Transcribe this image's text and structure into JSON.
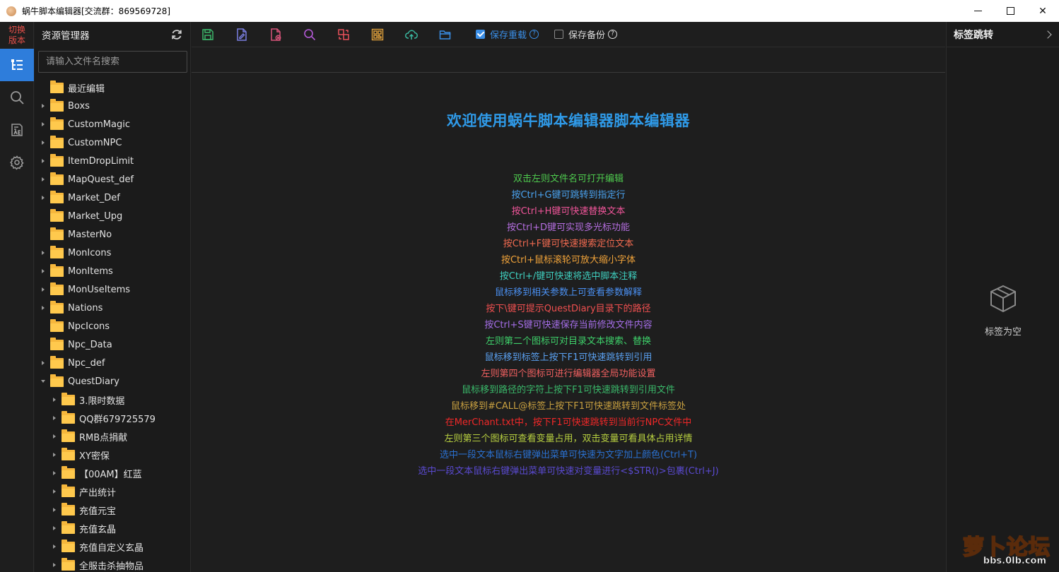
{
  "window": {
    "title": "蜗牛脚本编辑器[交流群：869569728]",
    "controls": {
      "minimize": "minimize-icon",
      "maximize": "maximize-icon",
      "close": "✕"
    }
  },
  "activity_bar": {
    "switch_version": [
      "切换",
      "版本"
    ],
    "items": [
      {
        "icon": "file-tree-icon",
        "active": true
      },
      {
        "icon": "search-icon",
        "active": false
      },
      {
        "icon": "variable-icon",
        "active": false
      },
      {
        "icon": "gear-icon",
        "active": false
      }
    ]
  },
  "explorer": {
    "title": "资源管理器",
    "search_placeholder": "请输入文件名搜索",
    "tree": [
      {
        "label": "最近编辑",
        "depth": 0,
        "caret": "none"
      },
      {
        "label": "Boxs",
        "depth": 0,
        "caret": "right"
      },
      {
        "label": "CustomMagic",
        "depth": 0,
        "caret": "right"
      },
      {
        "label": "CustomNPC",
        "depth": 0,
        "caret": "right"
      },
      {
        "label": "ItemDropLimit",
        "depth": 0,
        "caret": "right"
      },
      {
        "label": "MapQuest_def",
        "depth": 0,
        "caret": "right"
      },
      {
        "label": "Market_Def",
        "depth": 0,
        "caret": "right"
      },
      {
        "label": "Market_Upg",
        "depth": 0,
        "caret": "none"
      },
      {
        "label": "MasterNo",
        "depth": 0,
        "caret": "none"
      },
      {
        "label": "MonIcons",
        "depth": 0,
        "caret": "right"
      },
      {
        "label": "MonItems",
        "depth": 0,
        "caret": "right"
      },
      {
        "label": "MonUseItems",
        "depth": 0,
        "caret": "right"
      },
      {
        "label": "Nations",
        "depth": 0,
        "caret": "right"
      },
      {
        "label": "NpcIcons",
        "depth": 0,
        "caret": "none"
      },
      {
        "label": "Npc_Data",
        "depth": 0,
        "caret": "none"
      },
      {
        "label": "Npc_def",
        "depth": 0,
        "caret": "right"
      },
      {
        "label": "QuestDiary",
        "depth": 0,
        "caret": "down"
      },
      {
        "label": "3.限时数据",
        "depth": 1,
        "caret": "right"
      },
      {
        "label": "QQ群679725579",
        "depth": 1,
        "caret": "right"
      },
      {
        "label": "RMB点捐献",
        "depth": 1,
        "caret": "right"
      },
      {
        "label": "XY密保",
        "depth": 1,
        "caret": "right"
      },
      {
        "label": "【00AM】红蓝",
        "depth": 1,
        "caret": "right"
      },
      {
        "label": "产出统计",
        "depth": 1,
        "caret": "right"
      },
      {
        "label": "充值元宝",
        "depth": 1,
        "caret": "right"
      },
      {
        "label": "充值玄晶",
        "depth": 1,
        "caret": "right"
      },
      {
        "label": "充值自定义玄晶",
        "depth": 1,
        "caret": "right"
      },
      {
        "label": "全服击杀抽物品",
        "depth": 1,
        "caret": "right"
      }
    ]
  },
  "toolbar": {
    "buttons": [
      {
        "icon": "save-icon",
        "color": "#3bb56a"
      },
      {
        "icon": "edit-file-icon",
        "color": "#7a7fe0"
      },
      {
        "icon": "close-file-icon",
        "color": "#d9547a"
      },
      {
        "icon": "search-icon",
        "color": "#b45ad8"
      },
      {
        "icon": "replace-icon",
        "color": "#e8505a"
      },
      {
        "icon": "qrcode-icon",
        "color": "#e0a03a"
      },
      {
        "icon": "cloud-upload-icon",
        "color": "#3ab8a0"
      },
      {
        "icon": "folder-open-icon",
        "color": "#3a8ee6"
      }
    ],
    "save_reload": {
      "label": "保存重载",
      "checked": true,
      "color": "#3a8ee6"
    },
    "save_backup": {
      "label": "保存备份",
      "checked": false,
      "color": "#dddddd"
    }
  },
  "welcome": {
    "title": "欢迎使用蜗牛脚本编辑器脚本编辑器",
    "tips": [
      {
        "text": "双击左则文件名可打开编辑",
        "color": "#4ec94e"
      },
      {
        "text": "按Ctrl+G键可跳转到指定行",
        "color": "#4aa3f0"
      },
      {
        "text": "按Ctrl+H键可快速替换文本",
        "color": "#f0559a"
      },
      {
        "text": "按Ctrl+D键可实现多光标功能",
        "color": "#b56ee0"
      },
      {
        "text": "按Ctrl+F键可快速搜索定位文本",
        "color": "#f06a50"
      },
      {
        "text": "按Ctrl+鼠标滚轮可放大缩小字体",
        "color": "#f2a43a"
      },
      {
        "text": "按Ctrl+/键可快速将选中脚本注释",
        "color": "#3fd0c0"
      },
      {
        "text": "鼠标移到相关参数上可查看参数解释",
        "color": "#4a8ff0"
      },
      {
        "text": "按下\\键可提示QuestDiary目录下的路径",
        "color": "#f05050"
      },
      {
        "text": "按Ctrl+S键可快速保存当前修改文件内容",
        "color": "#a56ee8"
      },
      {
        "text": "左则第二个图标可对目录文本搜索、替换",
        "color": "#3ed06a"
      },
      {
        "text": "鼠标移到标签上按下F1可快速跳转到引用",
        "color": "#5aa0f0"
      },
      {
        "text": "左则第四个图标可进行编辑器全局功能设置",
        "color": "#f06060"
      },
      {
        "text": "鼠标移到路径的字符上按下F1可快速跳转到引用文件",
        "color": "#3ab86a"
      },
      {
        "text": "鼠标移到#CALL@标签上按下F1可快速跳转到文件标签处",
        "color": "#c8a040"
      },
      {
        "text": "在MerChant.txt中，按下F1可快速跳转到当前行NPC文件中",
        "color": "#f02828"
      },
      {
        "text": "左则第三个图标可查看变量占用，双击变量可看具体占用详情",
        "color": "#b8d040"
      },
      {
        "text": "选中一段文本鼠标右键弹出菜单可快速为文字加上颜色(Ctrl+T)",
        "color": "#2a70d0"
      },
      {
        "text": "选中一段文本鼠标右键弹出菜单可快速对变量进行<$STR()>包裹(Ctrl+J)",
        "color": "#5a4ad0"
      }
    ]
  },
  "bookmark_panel": {
    "title": "标签跳转",
    "empty_text": "标签为空"
  },
  "watermark": {
    "title": "萝卜论坛",
    "url": "bbs.0lb.com"
  }
}
